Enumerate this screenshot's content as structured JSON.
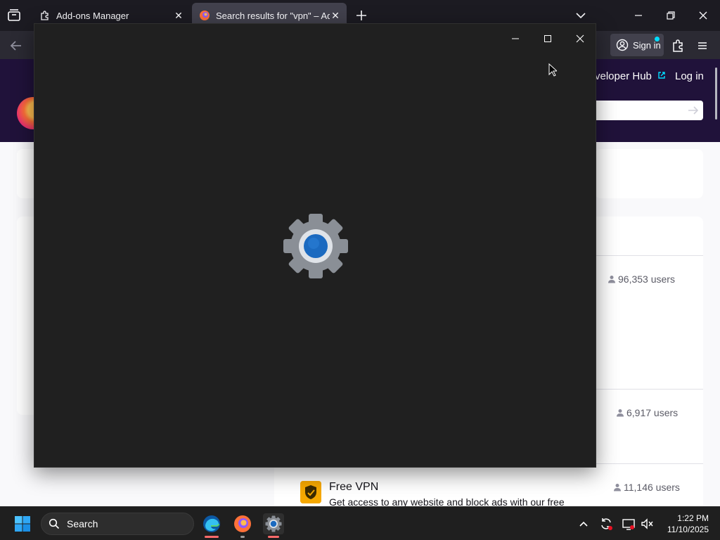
{
  "browser": {
    "tabs": [
      {
        "label": "Add-ons Manager",
        "active": false
      },
      {
        "label": "Search results for \"vpn\" – Add-ons",
        "active": true
      }
    ],
    "sign_in_label": "Sign in"
  },
  "page": {
    "header_links": {
      "developer_hub": "veloper Hub",
      "log_in": "Log in"
    },
    "results": [
      {
        "users": "96,353 users"
      },
      {
        "users": "6,917 users"
      },
      {
        "title": "Free VPN",
        "description": "Get access to any website and block ads with our free",
        "users": "11,146 users"
      }
    ]
  },
  "settings_window": {
    "splash_icon": "settings-gear-icon"
  },
  "taskbar": {
    "search_label": "Search",
    "time": "1:22 PM",
    "date": "11/10/2025"
  },
  "colors": {
    "page_header": "#20123a",
    "settings_bg": "#202020",
    "gear_gray": "#8a8f96",
    "gear_center": "#1b6ac0",
    "result_icon": "#f6a800",
    "taskbar_bg": "#1f1f1f"
  }
}
